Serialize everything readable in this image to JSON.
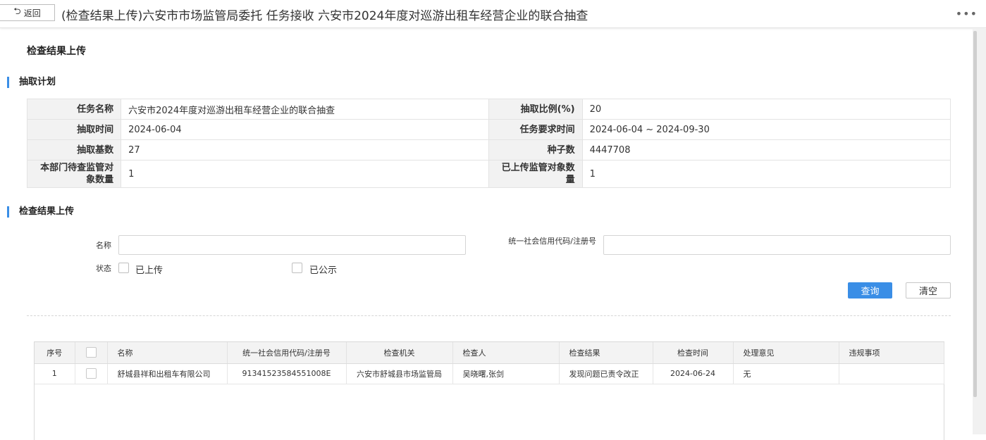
{
  "topbar": {
    "back_label": "返回",
    "title": "(检查结果上传)六安市市场监管局委托 任务接收 六安市2024年度对巡游出租车经营企业的联合抽查",
    "more_icon": "more-horizontal-icon"
  },
  "page": {
    "section_title": "检查结果上传"
  },
  "plan": {
    "heading": "抽取计划",
    "rows": [
      {
        "label1": "任务名称",
        "value1": "六安市2024年度对巡游出租车经营企业的联合抽查",
        "label2": "抽取比例(%)",
        "value2": "20"
      },
      {
        "label1": "抽取时间",
        "value1": "2024-06-04",
        "label2": "任务要求时间",
        "value2": "2024-06-04 ~ 2024-09-30"
      },
      {
        "label1": "抽取基数",
        "value1": "27",
        "label2": "种子数",
        "value2": "4447708"
      },
      {
        "label1": "本部门待查监管对象数量",
        "value1": "1",
        "label2": "已上传监管对象数量",
        "value2": "1"
      }
    ]
  },
  "upload": {
    "heading": "检查结果上传",
    "name_label": "名称",
    "name_value": "",
    "code_label": "统一社会信用代码/注册号",
    "code_value": "",
    "status_label": "状态",
    "uploaded_label": "已上传",
    "published_label": "已公示",
    "query_button": "查询",
    "clear_button": "清空"
  },
  "grid": {
    "columns": [
      "序号",
      "",
      "名称",
      "统一社会信用代码/注册号",
      "检查机关",
      "检查人",
      "检查结果",
      "检查时间",
      "处理意见",
      "违规事项"
    ],
    "rows": [
      {
        "index": "1",
        "name": "舒城县祥和出租车有限公司",
        "code": "91341523584551008E",
        "authority": "六安市舒城县市场监管局",
        "inspector": "吴晓曙,张剑",
        "result": "发现问题已责令改正",
        "time": "2024-06-24",
        "opinion": "无",
        "violation": ""
      }
    ]
  },
  "colors": {
    "accent": "#3a8ee6",
    "label_bg": "#f2f2f2",
    "border": "#e3e3e3"
  }
}
